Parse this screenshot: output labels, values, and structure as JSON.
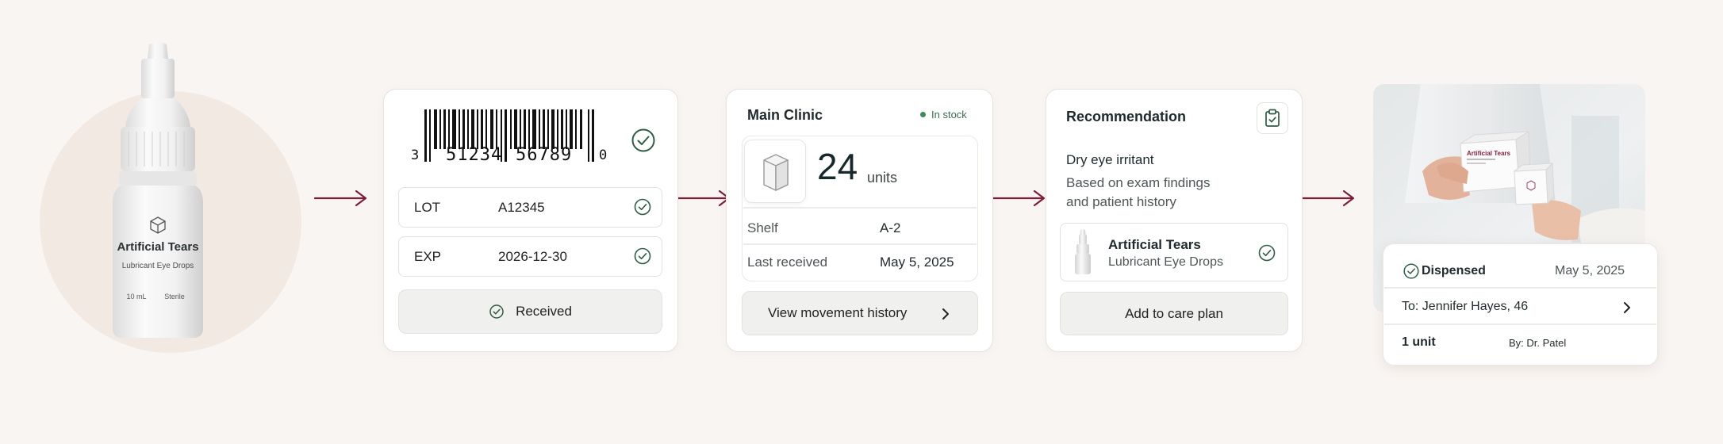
{
  "colors": {
    "accent": "#7a1f3d",
    "success": "#3f8a5c",
    "background": "#f9f5f2"
  },
  "product": {
    "name": "Artificial Tears",
    "subtitle": "Lubricant Eye Drops",
    "volume": "10 mL",
    "sterility": "Sterile",
    "icon": "cube-icon"
  },
  "receive_card": {
    "barcode": {
      "first": "3",
      "group1": "51234",
      "group2": "56789",
      "last": "0"
    },
    "lot": {
      "label": "LOT",
      "value": "A12345"
    },
    "exp": {
      "label": "EXP",
      "value": "2026-12-30"
    },
    "received_label": "Received"
  },
  "inventory_card": {
    "location": "Main Clinic",
    "status": "In stock",
    "quantity": "24",
    "unit": "units",
    "shelf": {
      "label": "Shelf",
      "value": "A-2"
    },
    "last_received": {
      "label": "Last received",
      "value": "May 5, 2025"
    },
    "history_button": "View movement history"
  },
  "recommendation_card": {
    "title": "Recommendation",
    "diagnosis": "Dry eye irritant",
    "basis": "Based on exam findings and patient history",
    "product_name": "Artificial Tears",
    "product_sub": "Lubricant Eye Drops",
    "action_button": "Add to care plan"
  },
  "dispense_card": {
    "status": "Dispensed",
    "date": "May 5, 2025",
    "patient": "To: Jennifer Hayes, 46",
    "quantity": "1 unit",
    "by": "By: Dr. Patel",
    "photo_box_label": "Artificial Tears"
  }
}
